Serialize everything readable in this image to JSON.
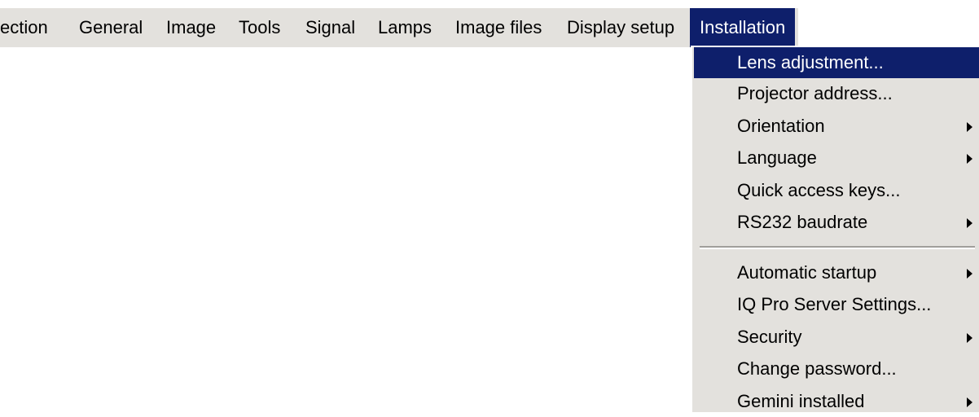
{
  "menubar": {
    "items": [
      {
        "label": "ection"
      },
      {
        "label": "General"
      },
      {
        "label": "Image"
      },
      {
        "label": "Tools"
      },
      {
        "label": "Signal"
      },
      {
        "label": "Lamps"
      },
      {
        "label": "Image files"
      },
      {
        "label": "Display setup"
      },
      {
        "label": "Installation"
      }
    ]
  },
  "installation_menu": {
    "items": [
      {
        "label": "Lens adjustment...",
        "submenu": false,
        "highlighted": true
      },
      {
        "label": "Projector address...",
        "submenu": false
      },
      {
        "label": "Orientation",
        "submenu": true
      },
      {
        "label": "Language",
        "submenu": true
      },
      {
        "label": "Quick access keys...",
        "submenu": false
      },
      {
        "label": "RS232 baudrate",
        "submenu": true
      },
      {
        "label": "Automatic startup",
        "submenu": true
      },
      {
        "label": "IQ Pro Server Settings...",
        "submenu": false
      },
      {
        "label": "Security",
        "submenu": true
      },
      {
        "label": "Change password...",
        "submenu": false
      },
      {
        "label": "Gemini installed",
        "submenu": true
      }
    ]
  },
  "colors": {
    "menu_background": "#e3e1dd",
    "highlight": "#0e1f6b",
    "highlight_text": "#ffffff"
  }
}
